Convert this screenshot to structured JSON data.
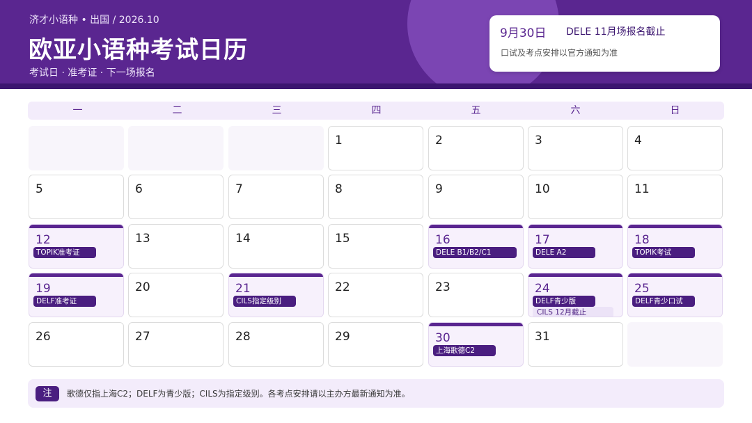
{
  "header": {
    "breadcrumb": "济才小语种 • 出国  /  2026.10",
    "title": "欧亚小语种考试日历",
    "subtitle": "考试日 · 准考证 · 下一场报名"
  },
  "notice": {
    "date": "9月30日",
    "title": "DELE 11月场报名截止",
    "note": "口试及考点安排以官方通知为准"
  },
  "weekdays": [
    "一",
    "二",
    "三",
    "四",
    "五",
    "六",
    "日"
  ],
  "days": [
    {
      "day": "1"
    },
    {
      "day": "2"
    },
    {
      "day": "3"
    },
    {
      "day": "4"
    },
    {
      "day": "5"
    },
    {
      "day": "6"
    },
    {
      "day": "7"
    },
    {
      "day": "8"
    },
    {
      "day": "9"
    },
    {
      "day": "10"
    },
    {
      "day": "11"
    },
    {
      "day": "12",
      "tag": "TOPIK准考证"
    },
    {
      "day": "13"
    },
    {
      "day": "14"
    },
    {
      "day": "15"
    },
    {
      "day": "16",
      "tag": "DELE B1/B2/C1"
    },
    {
      "day": "17",
      "tag": "DELE A2"
    },
    {
      "day": "18",
      "tag": "TOPIK考试"
    },
    {
      "day": "19",
      "tag": "DELF准考证"
    },
    {
      "day": "20"
    },
    {
      "day": "21",
      "tag": "CILS指定级别"
    },
    {
      "day": "22"
    },
    {
      "day": "23"
    },
    {
      "day": "24",
      "tag": "DELF青少版",
      "tag2": "CILS 12月截止"
    },
    {
      "day": "25",
      "tag": "DELF青少口试"
    },
    {
      "day": "26"
    },
    {
      "day": "27"
    },
    {
      "day": "28"
    },
    {
      "day": "29"
    },
    {
      "day": "30",
      "tag": "上海歌德C2"
    },
    {
      "day": "31"
    }
  ],
  "footer": {
    "badge": "注",
    "text": "歌德仅指上海C2；DELF为青少版；CILS为指定级别。各考点安排请以主办方最新通知为准。"
  }
}
